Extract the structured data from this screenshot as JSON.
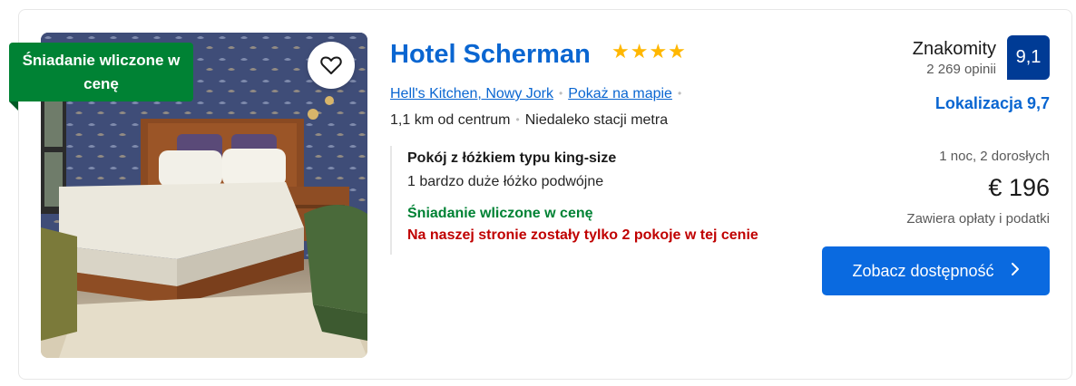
{
  "hotel": {
    "name": "Hotel Scherman",
    "stars": "★★★★",
    "neighborhood_link": "Hell's Kitchen, Nowy Jork",
    "map_link": "Pokaż na mapie",
    "distance": "1,1 km od centrum",
    "transit": "Niedaleko stacji metra"
  },
  "ribbon": {
    "text": "Śniadanie wliczone w cenę"
  },
  "room": {
    "title": "Pokój z łóżkiem typu king-size",
    "bed": "1 bardzo duże łóżko podwójne",
    "breakfast": "Śniadanie wliczone w cenę",
    "scarcity": "Na naszej stronie zostały tylko 2 pokoje w tej cenie"
  },
  "review": {
    "word": "Znakomity",
    "count": "2 269 opinii",
    "score": "9,1",
    "location_score": "Lokalizacja 9,7"
  },
  "pricing": {
    "guests": "1 noc, 2 dorosłych",
    "price": "€ 196",
    "taxes": "Zawiera opłaty i podatki",
    "cta_label": "Zobacz dostępność"
  },
  "icons": {
    "favorite": "heart-icon",
    "cta_arrow": "chevron-right-icon"
  },
  "colors": {
    "brand_blue": "#0a66d1",
    "badge_blue": "#003b95",
    "green": "#008234",
    "red": "#c00000",
    "star": "#ffb700"
  }
}
